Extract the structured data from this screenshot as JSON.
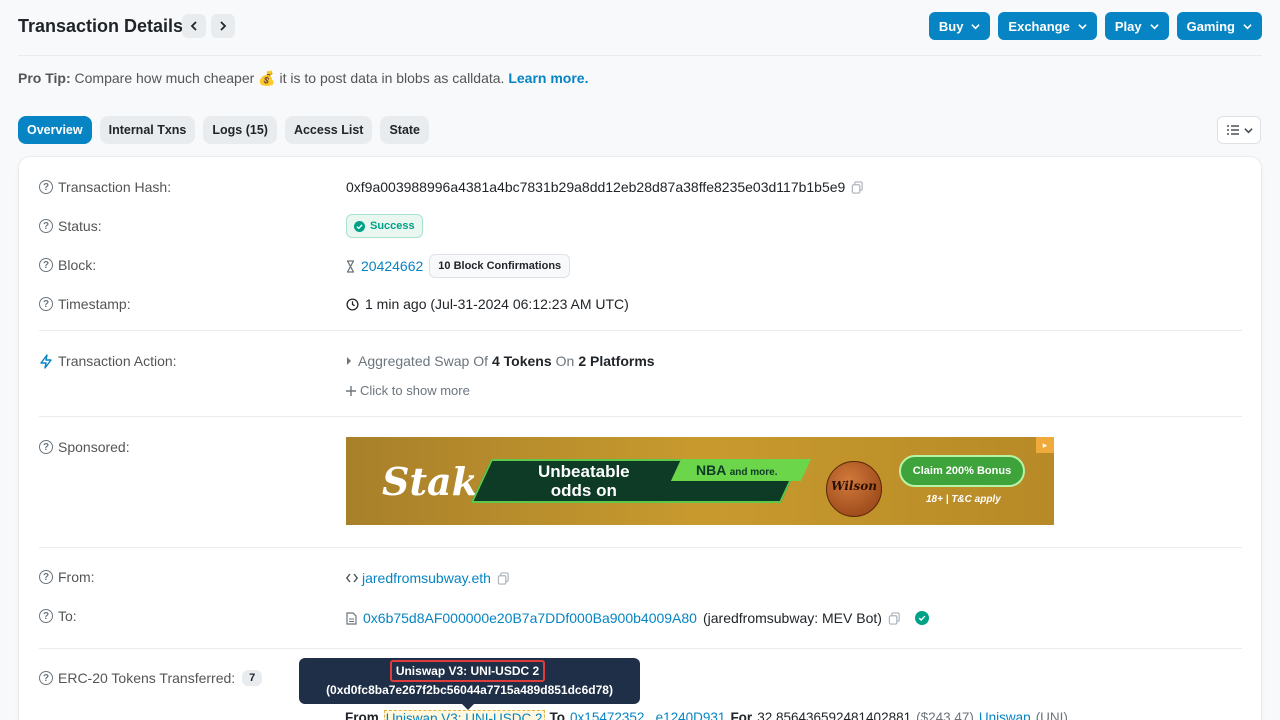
{
  "header": {
    "title": "Transaction Details",
    "menu": [
      {
        "label": "Buy"
      },
      {
        "label": "Exchange"
      },
      {
        "label": "Play"
      },
      {
        "label": "Gaming"
      }
    ]
  },
  "pro_tip": {
    "label": "Pro Tip:",
    "text_before": "Compare how much cheaper",
    "emoji": "💰",
    "text_after": "it is to post data in blobs as calldata.",
    "link": "Learn more."
  },
  "tabs": [
    {
      "label": "Overview",
      "active": true
    },
    {
      "label": "Internal Txns"
    },
    {
      "label": "Logs (15)"
    },
    {
      "label": "Access List"
    },
    {
      "label": "State"
    }
  ],
  "details": {
    "hash_label": "Transaction Hash:",
    "hash_value": "0xf9a003988996a4381a4bc7831b29a8dd12eb28d87a38ffe8235e03d117b1b5e9",
    "status_label": "Status:",
    "status_value": "Success",
    "block_label": "Block:",
    "block_value": "20424662",
    "block_confirmations": "10 Block Confirmations",
    "timestamp_label": "Timestamp:",
    "timestamp_value": "1 min ago (Jul-31-2024 06:12:23 AM UTC)",
    "action_label": "Transaction Action:",
    "action_prefix": "Aggregated Swap Of",
    "action_tokens": "4 Tokens",
    "action_on": "On",
    "action_platforms": "2 Platforms",
    "show_more": "Click to show more",
    "sponsored_label": "Sponsored:",
    "from_label": "From:",
    "from_value": "jaredfromsubway.eth",
    "to_label": "To:",
    "to_value": "0x6b75d8AF000000e20B7a7DDf000Ba900b4009A80",
    "to_name": "(jaredfromsubway: MEV Bot)",
    "erc20_label": "ERC-20 Tokens Transferred:",
    "erc20_count": "7"
  },
  "ad": {
    "logo": "Stake",
    "title_line1": "Unbeatable",
    "title_line2": "odds on",
    "nba": "NBA",
    "nba_sub": "and more.",
    "ball_text": "Wilson",
    "cta": "Claim 200% Bonus",
    "tc": "18+ | T&C apply"
  },
  "tooltip": {
    "name": "Uniswap V3: UNI-USDC 2",
    "address": "(0xd0fc8ba7e267f2bc56044a7715a489d851dc6d78)"
  },
  "transfer": {
    "from_label": "From",
    "from_value": "Uniswap V3: UNI-USDC 2",
    "to_label": "To",
    "to_value": "0x15472352...e1240D931",
    "for_label": "For",
    "amount": "32.856436592481402881",
    "usd": "($243.47)",
    "token": "Uniswap",
    "token_symbol": "(UNI)"
  }
}
